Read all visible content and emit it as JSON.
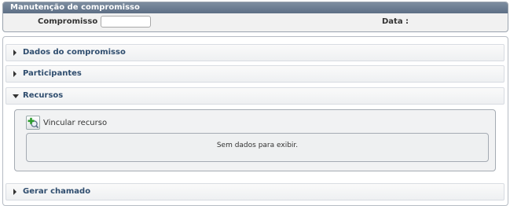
{
  "header": {
    "title": "Manutenção de compromisso",
    "compromisso_label": "Compromisso :",
    "compromisso_value": "",
    "data_label": "Data :"
  },
  "sections": {
    "dados": "Dados do compromisso",
    "participantes": "Participantes",
    "recursos": "Recursos",
    "gerar": "Gerar chamado"
  },
  "recursos": {
    "vincular_label": "Vincular recurso",
    "icon": "add-search-icon",
    "empty_text": "Sem dados para exibir."
  },
  "colors": {
    "header_bar": "#6b7b90",
    "section_title": "#2f4d6e",
    "icon_plus": "#2e9e2e"
  }
}
